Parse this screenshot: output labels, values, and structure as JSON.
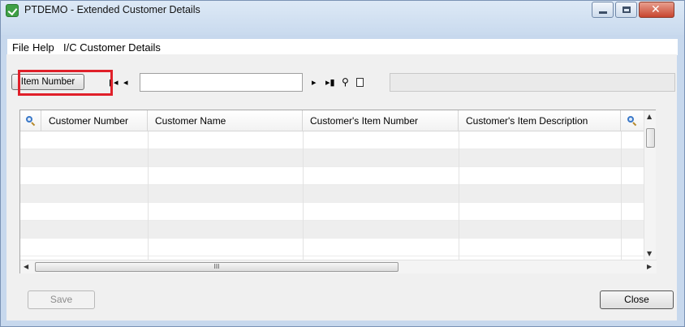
{
  "window": {
    "title": "PTDEMO - Extended Customer Details",
    "close_glyph": "✕",
    "accent_color": "#3fa046"
  },
  "menu": {
    "file": "File",
    "help": "Help",
    "ic_details": "I/C Customer Details"
  },
  "toolbar": {
    "lookup_button_label": "Item Number",
    "key_value": "",
    "description_value": "",
    "highlight_color": "#e0202a",
    "icons": {
      "first": "▮◂",
      "prev": "◂",
      "next": "▸",
      "last": "▸▮",
      "search": "⚲"
    }
  },
  "grid": {
    "columns": [
      "Customer Number",
      "Customer Name",
      "Customer's Item Number",
      "Customer's Item Description"
    ],
    "rows": [
      [
        "",
        "",
        "",
        ""
      ],
      [
        "",
        "",
        "",
        ""
      ],
      [
        "",
        "",
        "",
        ""
      ],
      [
        "",
        "",
        "",
        ""
      ],
      [
        "",
        "",
        "",
        ""
      ],
      [
        "",
        "",
        "",
        ""
      ],
      [
        "",
        "",
        "",
        ""
      ]
    ],
    "scroll": {
      "up": "▲",
      "down": "▼",
      "left": "◀",
      "right": "▶",
      "grip": "III"
    }
  },
  "buttons": {
    "save": "Save",
    "close": "Close"
  }
}
